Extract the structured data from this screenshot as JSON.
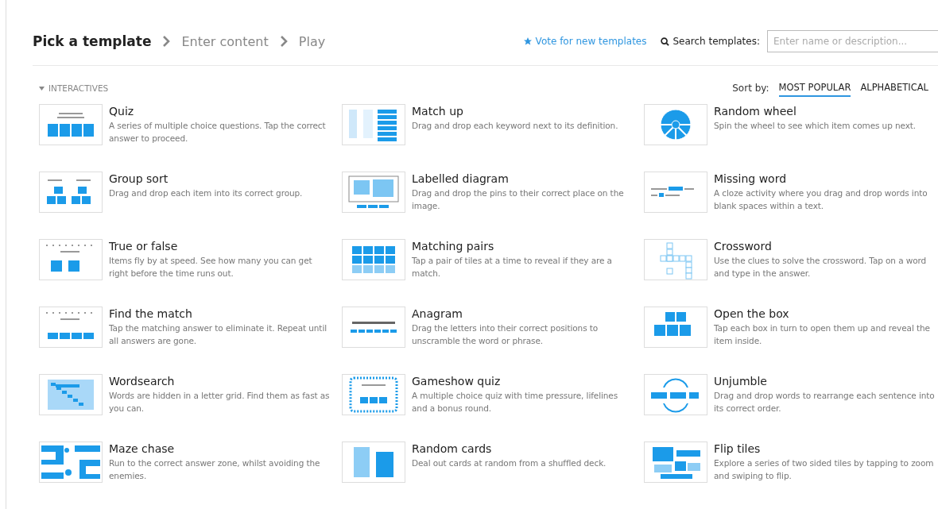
{
  "breadcrumb": [
    {
      "label": "Pick a template",
      "selected": true
    },
    {
      "label": "Enter content",
      "selected": false
    },
    {
      "label": "Play",
      "selected": false
    }
  ],
  "vote_link": "Vote for new templates",
  "search": {
    "label": "Search templates:",
    "placeholder": "Enter name or description..."
  },
  "section": {
    "title": "INTERACTIVES",
    "expanded": true
  },
  "sort": {
    "label": "Sort by:",
    "options": [
      {
        "label": "MOST POPULAR",
        "selected": true
      },
      {
        "label": "ALPHABETICAL",
        "selected": false
      }
    ]
  },
  "templates": [
    {
      "kind": "quiz",
      "name": "Quiz",
      "description": "A series of multiple choice questions. Tap the correct answer to proceed."
    },
    {
      "kind": "matchup",
      "name": "Match up",
      "description": "Drag and drop each keyword next to its definition."
    },
    {
      "kind": "wheel",
      "name": "Random wheel",
      "description": "Spin the wheel to see which item comes up next."
    },
    {
      "kind": "groups",
      "name": "Group sort",
      "description": "Drag and drop each item into its correct group."
    },
    {
      "kind": "diagram",
      "name": "Labelled diagram",
      "description": "Drag and drop the pins to their correct place on the image."
    },
    {
      "kind": "cloze",
      "name": "Missing word",
      "description": "A cloze activity where you drag and drop words into blank spaces within a text."
    },
    {
      "kind": "truefalse",
      "name": "True or false",
      "description": "Items fly by at speed. See how many you can get right before the time runs out."
    },
    {
      "kind": "pairs",
      "name": "Matching pairs",
      "description": "Tap a pair of tiles at a time to reveal if they are a match."
    },
    {
      "kind": "crossword",
      "name": "Crossword",
      "description": "Use the clues to solve the crossword. Tap on a word and type in the answer."
    },
    {
      "kind": "findmatch",
      "name": "Find the match",
      "description": "Tap the matching answer to eliminate it. Repeat until all answers are gone."
    },
    {
      "kind": "anagram",
      "name": "Anagram",
      "description": "Drag the letters into their correct positions to unscramble the word or phrase."
    },
    {
      "kind": "boxes",
      "name": "Open the box",
      "description": "Tap each box in turn to open them up and reveal the item inside."
    },
    {
      "kind": "wordsearch",
      "name": "Wordsearch",
      "description": "Words are hidden in a letter grid. Find them as fast as you can."
    },
    {
      "kind": "gameshow",
      "name": "Gameshow quiz",
      "description": "A multiple choice quiz with time pressure, lifelines and a bonus round."
    },
    {
      "kind": "unjumble",
      "name": "Unjumble",
      "description": "Drag and drop words to rearrange each sentence into its correct order."
    },
    {
      "kind": "maze",
      "name": "Maze chase",
      "description": "Run to the correct answer zone, whilst avoiding the enemies."
    },
    {
      "kind": "cards",
      "name": "Random cards",
      "description": "Deal out cards at random from a shuffled deck."
    },
    {
      "kind": "fliptiles",
      "name": "Flip tiles",
      "description": "Explore a series of two sided tiles by tapping to zoom and swiping to flip."
    }
  ]
}
